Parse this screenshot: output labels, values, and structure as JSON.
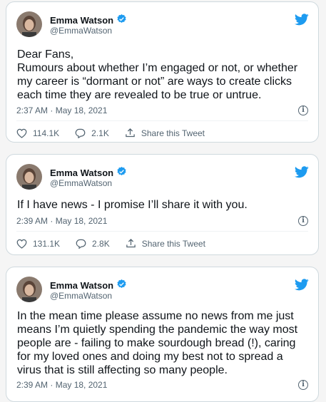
{
  "colors": {
    "accent": "#1d9bf0",
    "secondary_text": "#536471",
    "border": "#cfd9de"
  },
  "icons": {
    "verified": "verified-badge-icon",
    "twitter": "twitter-bird-icon",
    "like": "heart-icon",
    "reply": "reply-icon",
    "share": "share-icon",
    "info": "info-icon"
  },
  "tweets": [
    {
      "name": "Emma Watson",
      "handle": "@EmmaWatson",
      "text": "Dear Fans,\nRumours about whether I’m engaged or not, or whether\nmy career is “dormant or not” are ways to create clicks\neach time they are revealed to be true or untrue.",
      "timestamp": "2:37 AM · May 18, 2021",
      "likes": "114.1K",
      "replies": "2.1K",
      "share_label": "Share this Tweet"
    },
    {
      "name": "Emma Watson",
      "handle": "@EmmaWatson",
      "text": "If I have news - I promise I’ll share it with you.",
      "timestamp": "2:39 AM · May 18, 2021",
      "likes": "131.1K",
      "replies": "2.8K",
      "share_label": "Share this Tweet"
    },
    {
      "name": "Emma Watson",
      "handle": "@EmmaWatson",
      "text": "In the mean time please assume no news from me just\nmeans I’m quietly spending the pandemic the way most\npeople are - failing to make sourdough bread (!), caring\nfor my loved ones and doing my best not to spread a\nvirus that is still affecting so many people.",
      "timestamp": "2:39 AM · May 18, 2021"
    }
  ]
}
